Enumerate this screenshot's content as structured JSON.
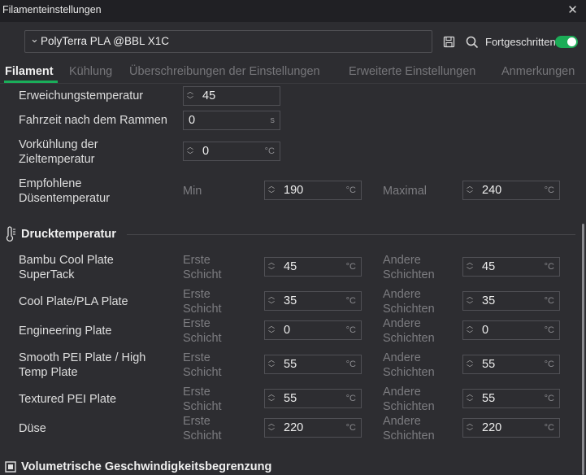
{
  "window": {
    "title": "Filamenteinstellungen",
    "close": "✕"
  },
  "toolbar": {
    "preset": "PolyTerra PLA @BBL X1C",
    "save_icon": "save-icon",
    "search_icon": "search-icon",
    "advanced_label": "Fortgeschritten",
    "advanced_enabled": true,
    "accent": "#1cac57"
  },
  "tabs": [
    "Filament",
    "Kühlung",
    "Überschreibungen der Einstellungen",
    "Erweiterte Einstellungen",
    "Anmerkungen"
  ],
  "active_tab": "Filament",
  "fields": {
    "softening": {
      "label": "Erweichungstemperatur",
      "value": "45"
    },
    "ramming": {
      "label": "Fahrzeit nach dem Rammen",
      "value": "0",
      "unit": "s"
    },
    "precool": {
      "label_1": "Vorkühlung der",
      "label_2": "Zieltemperatur",
      "value": "0",
      "unit": "°C"
    },
    "nozzle_range": {
      "label_1": "Empfohlene",
      "label_2": "Düsentemperatur",
      "min_label": "Min",
      "min_value": "190",
      "max_label": "Maximal",
      "max_value": "240",
      "unit": "°C"
    }
  },
  "print_temp": {
    "title": "Drucktemperatur",
    "icon": "thermometer-icon",
    "first_1": "Erste",
    "first_2": "Schicht",
    "other_1": "Andere",
    "other_2": "Schichten",
    "unit": "°C",
    "rows": [
      {
        "label_1": "Bambu Cool Plate",
        "label_2": "SuperTack",
        "first": "45",
        "other": "45"
      },
      {
        "label_1": "Cool Plate/PLA Plate",
        "label_2": "",
        "first": "35",
        "other": "35"
      },
      {
        "label_1": "Engineering Plate",
        "label_2": "",
        "first": "0",
        "other": "0"
      },
      {
        "label_1": "Smooth PEI Plate / High",
        "label_2": "Temp Plate",
        "first": "55",
        "other": "55"
      },
      {
        "label_1": "Textured PEI Plate",
        "label_2": "",
        "first": "55",
        "other": "55"
      },
      {
        "label_1": "Düse",
        "label_2": "",
        "first": "220",
        "other": "220"
      }
    ]
  },
  "volumetric": {
    "title": "Volumetrische Geschwindigkeitsbegrenzung",
    "icon": "speed-limit-icon"
  }
}
